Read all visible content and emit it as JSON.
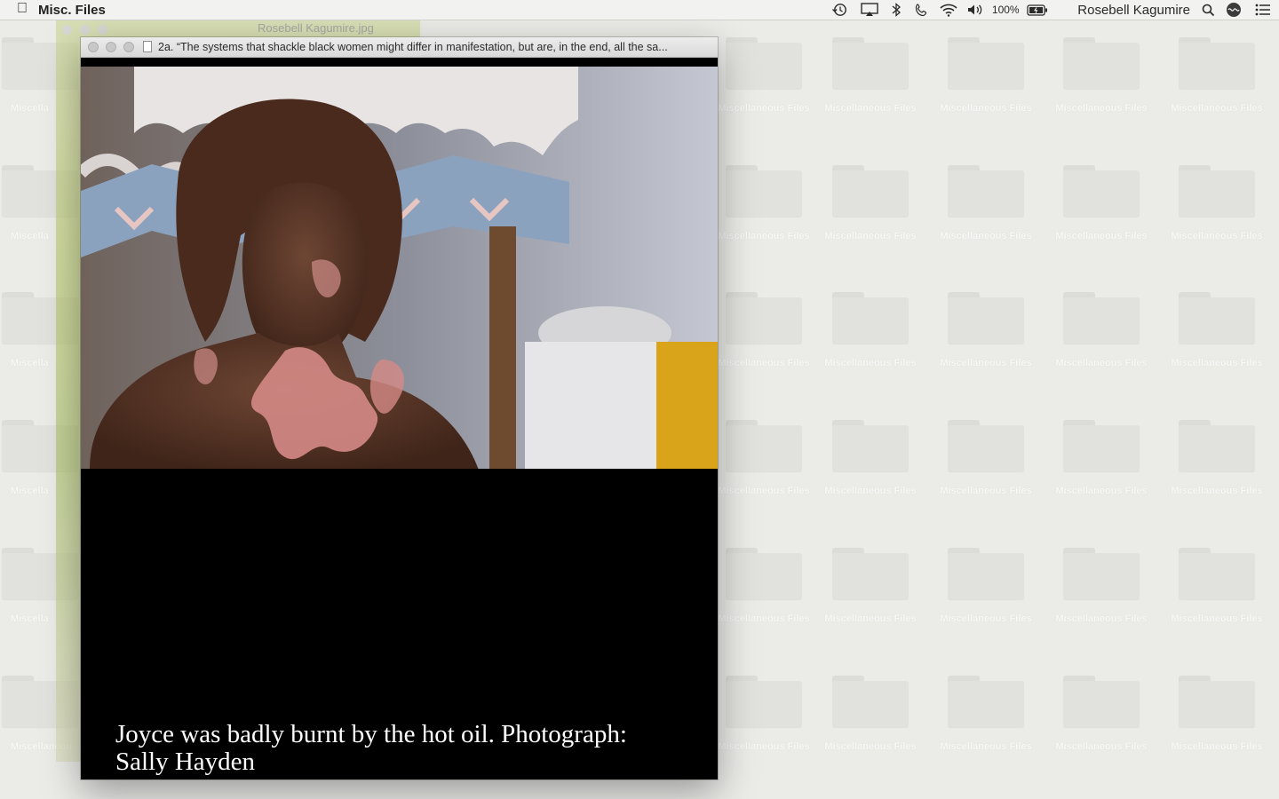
{
  "menubar": {
    "app_name": "Misc. Files",
    "battery": "100%",
    "user": "Rosebell Kagumire",
    "icons": [
      "apple-icon",
      "time-machine-icon",
      "airplay-icon",
      "bluetooth-icon",
      "phone-icon",
      "wifi-icon",
      "volume-icon",
      "battery-icon",
      "spotlight-icon",
      "siri-icon",
      "notification-center-icon"
    ]
  },
  "background_window": {
    "title": "Rosebell Kagumire.jpg"
  },
  "desktop": {
    "item_label": "Miscellaneous Files",
    "left_column_label": "Miscella",
    "bottom_left_label": "Miscellaneou"
  },
  "preview": {
    "title": "2a. “The systems that shackle black women might differ in manifestation, but are, in the end, all the sa...",
    "caption": "Joyce was badly burnt by the hot oil. Photograph: Sally Hayden"
  },
  "colors": {
    "desktop_bg": "#ebebe8",
    "window_bg": "#000000",
    "caption_text": "#ffffff"
  }
}
